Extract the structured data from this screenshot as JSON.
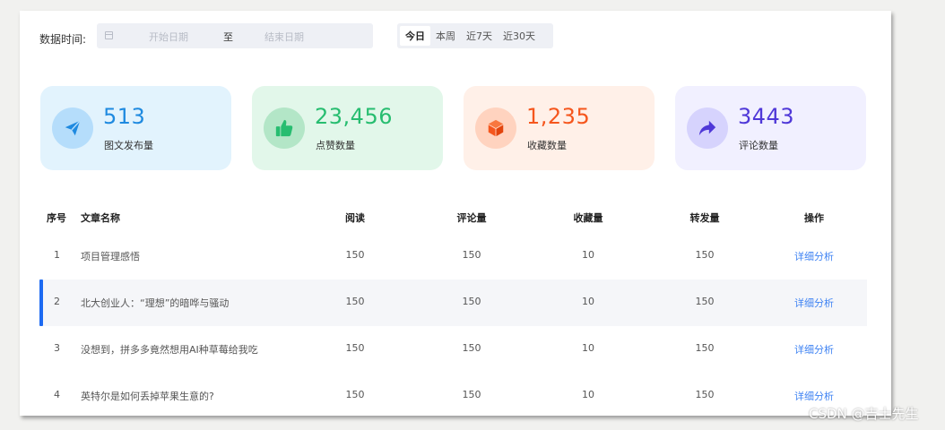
{
  "filter": {
    "label": "数据时间:",
    "start_placeholder": "开始日期",
    "separator": "至",
    "end_placeholder": "结束日期",
    "quick_ranges": [
      "今日",
      "本周",
      "近7天",
      "近30天"
    ],
    "active_range": "今日"
  },
  "stats": [
    {
      "value": "513",
      "label": "图文发布量",
      "icon": "send-icon",
      "color": "#1f8ae0"
    },
    {
      "value": "23,456",
      "label": "点赞数量",
      "icon": "thumbs-up-icon",
      "color": "#27bd70"
    },
    {
      "value": "1,235",
      "label": "收藏数量",
      "icon": "box-icon",
      "color": "#f5561d"
    },
    {
      "value": "3443",
      "label": "评论数量",
      "icon": "share-arrow-icon",
      "color": "#4f38d8"
    }
  ],
  "table": {
    "columns": [
      "序号",
      "文章名称",
      "阅读",
      "评论量",
      "收藏量",
      "转发量",
      "操作"
    ],
    "rows": [
      {
        "index": "1",
        "title": "项目管理感悟",
        "reads": "150",
        "comments": "150",
        "favorites": "10",
        "shares": "150",
        "action": "详细分析"
      },
      {
        "index": "2",
        "title": "北大创业人：“理想”的暗哗与骚动",
        "reads": "150",
        "comments": "150",
        "favorites": "10",
        "shares": "150",
        "action": "详细分析"
      },
      {
        "index": "3",
        "title": "没想到，拼多多竟然想用AI种草莓给我吃",
        "reads": "150",
        "comments": "150",
        "favorites": "10",
        "shares": "150",
        "action": "详细分析"
      },
      {
        "index": "4",
        "title": "英特尔是如何丢掉苹果生意的?",
        "reads": "150",
        "comments": "150",
        "favorites": "10",
        "shares": "150",
        "action": "详细分析"
      }
    ],
    "highlighted_row": "2"
  },
  "watermark": "CSDN @吉士先生"
}
